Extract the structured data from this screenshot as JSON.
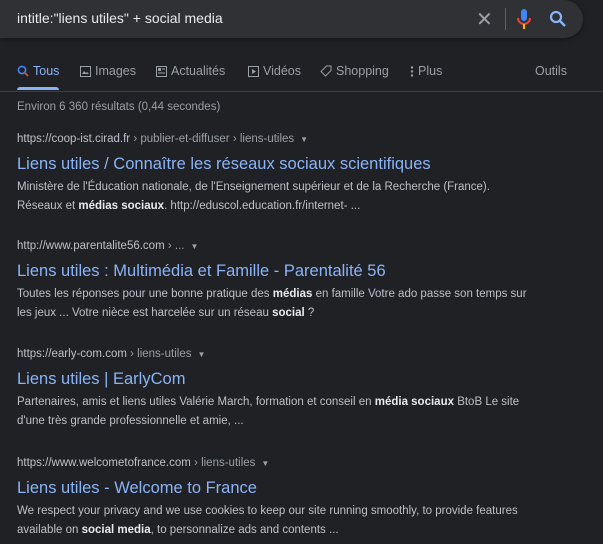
{
  "search": {
    "query": "intitle:\"liens utiles\" + social media"
  },
  "tabs": [
    {
      "label": "Tous",
      "icon": "search-icon",
      "active": true
    },
    {
      "label": "Images",
      "icon": "image-icon"
    },
    {
      "label": "Actualités",
      "icon": "news-icon"
    },
    {
      "label": "Vidéos",
      "icon": "video-icon"
    },
    {
      "label": "Shopping",
      "icon": "tag-icon"
    },
    {
      "label": "Plus",
      "icon": "more-vert-icon"
    }
  ],
  "tools_label": "Outils",
  "result_count": "Environ 6 360 résultats (0,44 secondes)",
  "colors": {
    "background": "#202124",
    "link": "#8ab4f8",
    "searchbox": "#303134"
  },
  "results": [
    {
      "site": "https://coop-ist.cirad.fr",
      "crumbs": " › publier-et-diffuser › liens-utiles",
      "title": "Liens utiles / Connaître les réseaux sociaux scientifiques",
      "snippet": [
        {
          "t": "Ministère de l'Éducation nationale, de l'Enseignement supérieur et de la Recherche (France). Réseaux et "
        },
        {
          "t": "médias sociaux",
          "b": true
        },
        {
          "t": ". http://eduscol.education.fr/internet- ..."
        }
      ]
    },
    {
      "site": "http://www.parentalite56.com",
      "crumbs": " › ...",
      "title": "Liens utiles : Multimédia et Famille - Parentalité 56",
      "snippet": [
        {
          "t": "Toutes les réponses pour une bonne pratique des "
        },
        {
          "t": "médias",
          "b": true
        },
        {
          "t": " en famille Votre ado passe son temps sur les jeux ... Votre nièce est harcelée sur un réseau "
        },
        {
          "t": "social",
          "b": true
        },
        {
          "t": " ?"
        }
      ]
    },
    {
      "site": "https://early-com.com",
      "crumbs": " › liens-utiles",
      "title": "Liens utiles | EarlyCom",
      "snippet": [
        {
          "t": "Partenaires, amis et liens utiles Valérie March, formation et conseil en "
        },
        {
          "t": "média sociaux",
          "b": true
        },
        {
          "t": " BtoB Le site d'une très grande professionnelle et amie, ..."
        }
      ]
    },
    {
      "site": "https://www.welcometofrance.com",
      "crumbs": " › liens-utiles",
      "title": "Liens utiles - Welcome to France",
      "snippet": [
        {
          "t": "We respect your privacy and we use cookies to keep our site running smoothly, to provide features available on "
        },
        {
          "t": "social media",
          "b": true
        },
        {
          "t": ", to personnalize ads and contents ..."
        }
      ]
    }
  ]
}
